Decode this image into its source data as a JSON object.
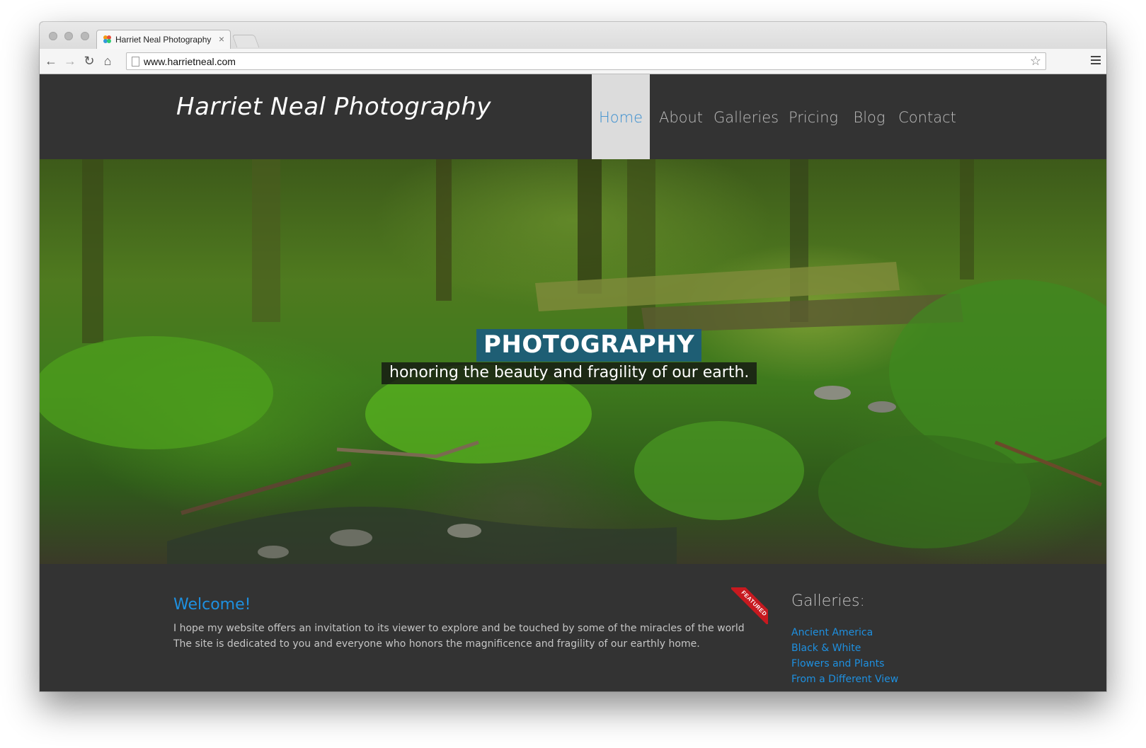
{
  "browser": {
    "tab_title": "Harriet Neal Photography",
    "tab_close": "×",
    "url": "www.harrietneal.com"
  },
  "site": {
    "title": "Harriet Neal Photography",
    "nav": [
      "Home",
      "About",
      "Galleries",
      "Pricing",
      "Blog",
      "Contact"
    ],
    "active_nav": "Home"
  },
  "hero": {
    "title": "PHOTOGRAPHY",
    "subtitle": "honoring the beauty and fragility of our earth."
  },
  "welcome": {
    "title": "Welcome!",
    "body": "I hope my website offers an invitation to its viewer to explore and be touched by some of the miracles of the world The site is dedicated to you and everyone who honors the magnificence and fragility of our earthly home.",
    "badge": "FEATURED"
  },
  "galleries": {
    "title": "Galleries:",
    "links": [
      "Ancient America",
      "Black & White",
      "Flowers and Plants",
      "From a Different View"
    ]
  },
  "colors": {
    "header_bg": "#333333",
    "link_blue": "#1e90e0",
    "active_nav_bg": "#dcdcdc",
    "hero_title_bg": "#165887",
    "ribbon_red": "#c7191f"
  },
  "icons": [
    "back-icon",
    "forward-icon",
    "reload-icon",
    "home-icon",
    "page-icon",
    "bookmark-star-icon",
    "menu-icon",
    "favicon-icon"
  ]
}
